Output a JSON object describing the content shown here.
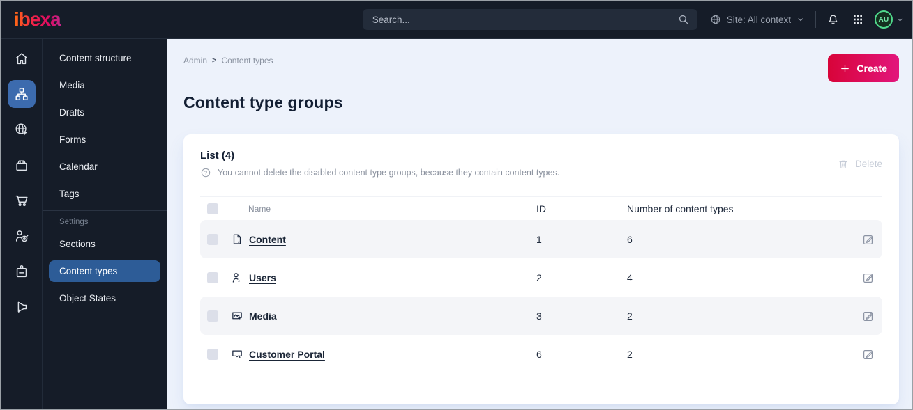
{
  "topbar": {
    "logo": "ibexa",
    "search_placeholder": "Search...",
    "site_context_label": "Site: All context",
    "avatar_initials": "AU"
  },
  "sidebar": {
    "rail_icons": [
      "home-icon",
      "content-structure-icon",
      "site-icon",
      "product-catalog-icon",
      "commerce-cart-icon",
      "customer-segments-icon",
      "company-badge-icon",
      "campaign-megaphone-icon"
    ],
    "menu_items": [
      {
        "label": "Content structure"
      },
      {
        "label": "Media"
      },
      {
        "label": "Drafts"
      },
      {
        "label": "Forms"
      },
      {
        "label": "Calendar"
      },
      {
        "label": "Tags"
      }
    ],
    "settings_label": "Settings",
    "settings_items": [
      {
        "label": "Sections"
      },
      {
        "label": "Content types",
        "active": true
      },
      {
        "label": "Object States"
      }
    ]
  },
  "main": {
    "breadcrumb": {
      "items": [
        "Admin",
        "Content types"
      ],
      "separator": ">"
    },
    "title": "Content type groups",
    "create_button": "Create",
    "card": {
      "list_title": "List (4)",
      "info_text": "You cannot delete the disabled content type groups, because they contain content types.",
      "delete_button": "Delete",
      "table": {
        "columns": [
          "Name",
          "ID",
          "Number of content types"
        ],
        "rows": [
          {
            "icon": "content-file-icon",
            "name": "Content",
            "id": "1",
            "count": "6"
          },
          {
            "icon": "users-person-icon",
            "name": "Users",
            "id": "2",
            "count": "4"
          },
          {
            "icon": "media-image-icon",
            "name": "Media",
            "id": "3",
            "count": "2"
          },
          {
            "icon": "customer-portal-monitor-icon",
            "name": "Customer Portal",
            "id": "6",
            "count": "2"
          }
        ]
      }
    }
  },
  "colors": {
    "topbar_bg": "#151c28",
    "menu_active_blue": "#2d5c97",
    "rail_active_blue": "#3c6bae",
    "content_bg": "#edf2fb",
    "create_gradient_start": "#d80439",
    "create_gradient_end": "#e2167c",
    "avatar_green": "#4fd78b",
    "row_stripe": "#f4f5f8"
  }
}
